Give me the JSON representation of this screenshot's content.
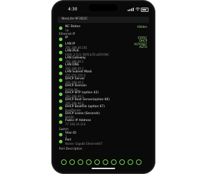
{
  "status": {
    "time": "4:30"
  },
  "header": {
    "title": "NeoLite-9F3D2C"
  },
  "rows": [
    {
      "label": "NC Status",
      "value": "Up"
    },
    {
      "label": "IP",
      "value": ""
    },
    {
      "label": "LAN IP",
      "value": "192.168.40.161"
    },
    {
      "label": "LAN IPv6",
      "value": "fd00::1:1c1::60f1:b7E:a65f:094"
    },
    {
      "label": "LAN Gateway",
      "value": "192.168.40.1"
    },
    {
      "label": "LAN DNS",
      "value": "192.168.40.1"
    },
    {
      "label": "LAN Subnet Mask",
      "value": "255.255.255.0"
    },
    {
      "label": "DHCP Server",
      "value": "192.168.40.1"
    },
    {
      "label": "DHCP Domain",
      "value": "home.lan"
    },
    {
      "label": "DHCP NTP (option 42)",
      "value": "192.168.40.1"
    },
    {
      "label": "DHCP Boot Server(option 66)",
      "value": "192.168.40.1"
    },
    {
      "label": "DHCP BootFile (option 67)",
      "value": "bootfile.bin"
    },
    {
      "label": "DHCP Lease (Seconds)",
      "value": "86400"
    },
    {
      "label": "Public IP Address",
      "value": "77.106.33.214"
    }
  ],
  "right_tags": {
    "row0": "Hidden",
    "row1a": "STATIC",
    "row1b": "DHCP",
    "row2a": "AUTOSET",
    "row2b": "AUTO"
  },
  "sections": {
    "ethernet_label": "Ethernet IP",
    "switch_label": "Switch",
    "port_desc_label": "Port Description"
  },
  "switch_rows": [
    {
      "label": "Vlan ID",
      "value": "1"
    },
    {
      "label": "Port",
      "value": "Name: Gigabit Ethernet0/7"
    }
  ]
}
